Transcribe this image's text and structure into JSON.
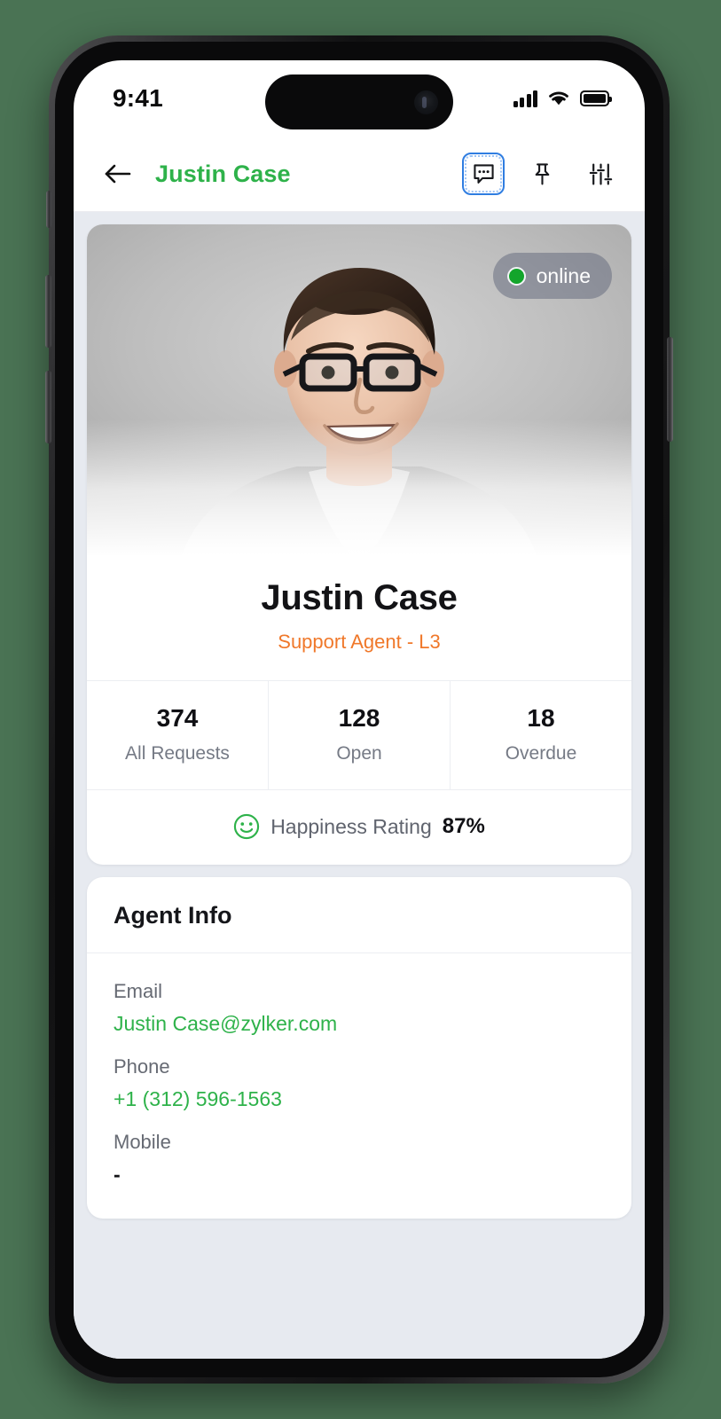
{
  "status_bar": {
    "time": "9:41",
    "cellular_icon": "signal-bars-icon",
    "wifi_icon": "wifi-icon",
    "battery_icon": "battery-full-icon"
  },
  "navbar": {
    "back_icon": "back-arrow-icon",
    "title": "Justin Case",
    "title_color": "#2eb24a",
    "actions": [
      {
        "name": "chat-bubble-icon",
        "label": "Chat",
        "focused": true
      },
      {
        "name": "pin-icon",
        "label": "Pin",
        "focused": false
      },
      {
        "name": "sliders-icon",
        "label": "Settings",
        "focused": false
      }
    ]
  },
  "profile": {
    "avatar_alt": "Justin Case portrait",
    "status_badge": {
      "label": "online",
      "dot_color": "#13a52b"
    },
    "name": "Justin Case",
    "role": "Support Agent - L3",
    "role_color": "#f0782a",
    "stats": [
      {
        "value": "374",
        "label": "All Requests"
      },
      {
        "value": "128",
        "label": "Open"
      },
      {
        "value": "18",
        "label": "Overdue"
      }
    ],
    "happiness": {
      "icon": "smiley-face-icon",
      "label": "Happiness Rating",
      "value": "87%"
    }
  },
  "agent_info": {
    "title": "Agent Info",
    "fields": [
      {
        "label": "Email",
        "value": "Justin Case@zylker.com",
        "link": true
      },
      {
        "label": "Phone",
        "value": "+1 (312) 596-1563",
        "link": true
      },
      {
        "label": "Mobile",
        "value": "-",
        "link": false
      }
    ]
  }
}
